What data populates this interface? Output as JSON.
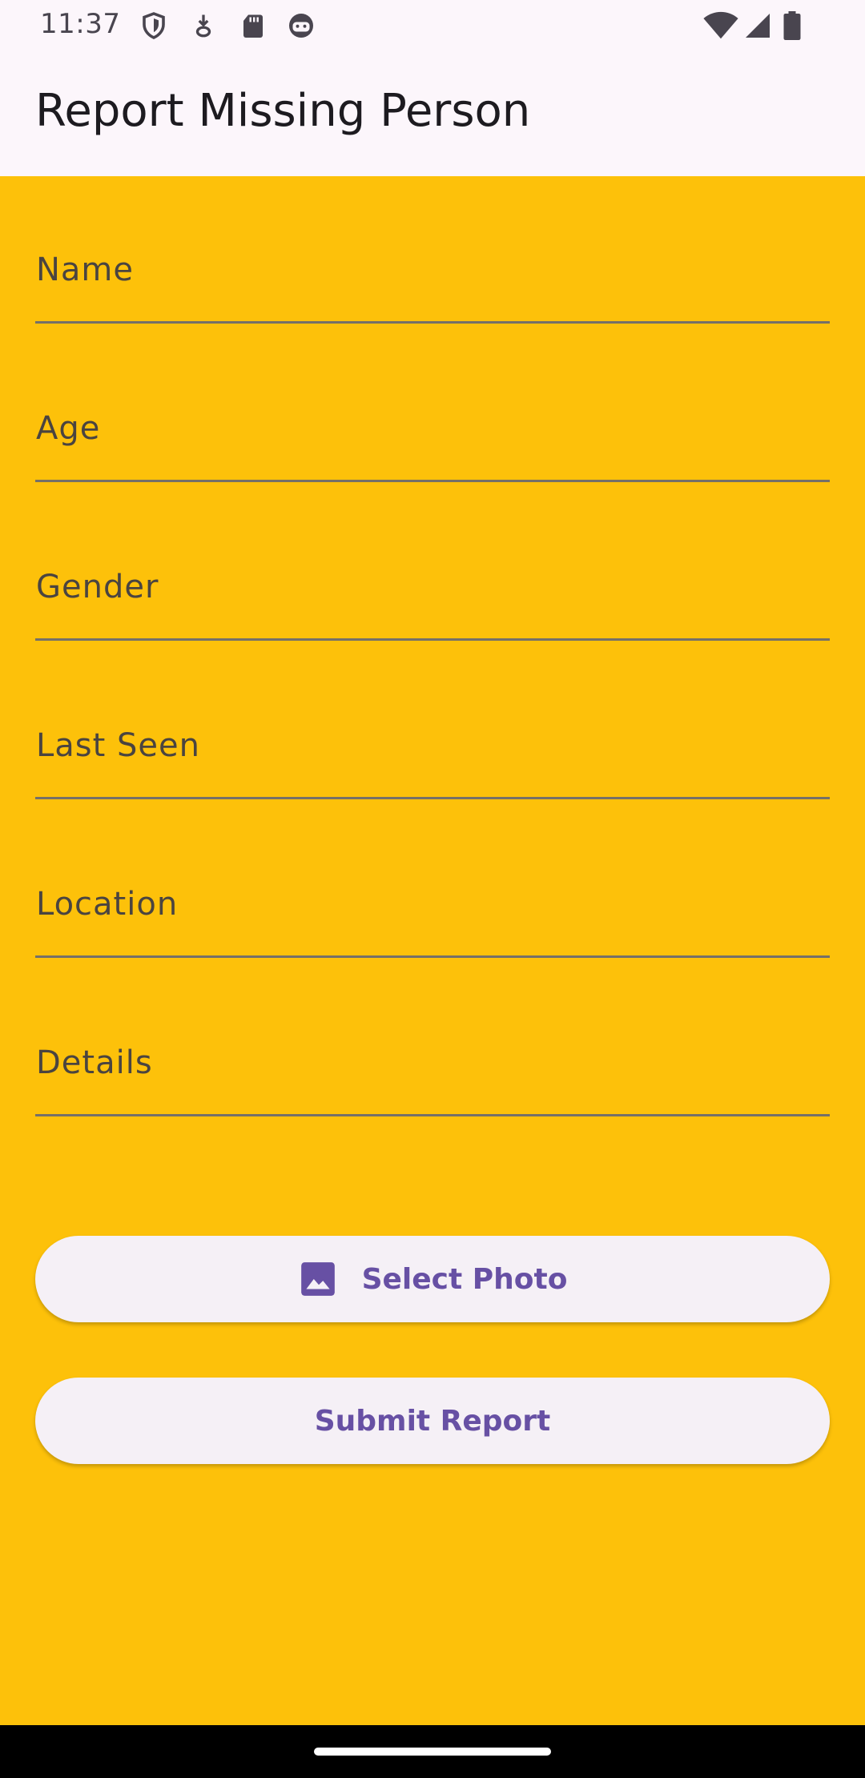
{
  "status_bar": {
    "time": "11:37",
    "left_icons": [
      "shield-icon",
      "download-badge-icon",
      "sd-card-icon",
      "face-icon"
    ],
    "right_icons": [
      "wifi-icon",
      "cell-signal-icon",
      "battery-icon"
    ]
  },
  "app_bar": {
    "title": "Report Missing Person"
  },
  "form": {
    "fields": [
      {
        "label": "Name",
        "value": ""
      },
      {
        "label": "Age",
        "value": ""
      },
      {
        "label": "Gender",
        "value": ""
      },
      {
        "label": "Last Seen",
        "value": ""
      },
      {
        "label": "Location",
        "value": ""
      },
      {
        "label": "Details",
        "value": ""
      }
    ],
    "select_photo_label": "Select Photo",
    "select_photo_icon": "image-icon",
    "submit_label": "Submit Report"
  },
  "colors": {
    "background": "#FDC10A",
    "app_bar": "#FCF6FB",
    "button_text": "#6750A4",
    "button_bg": "#F5F0F6"
  }
}
